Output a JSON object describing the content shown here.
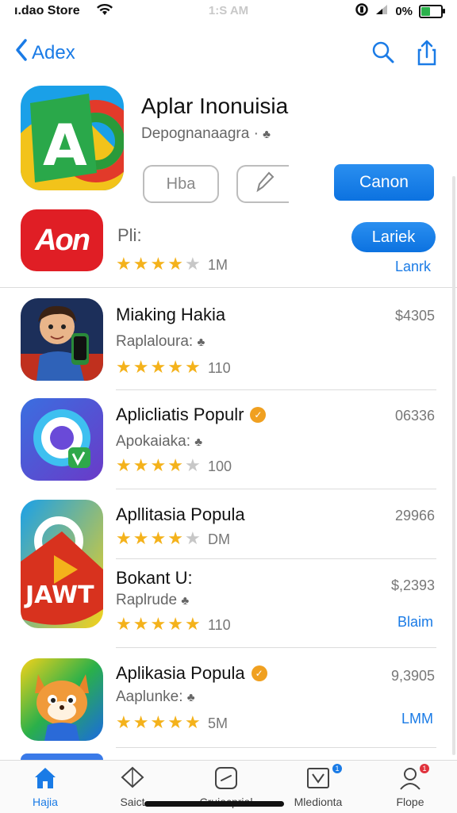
{
  "status_bar": {
    "carrier": "ı.dao Store",
    "time": "1:S AM",
    "battery": "0%",
    "battery_level": 0.5
  },
  "nav": {
    "back_label": "Adex"
  },
  "header_app": {
    "title": "Aplar Inonuisia",
    "subtitle": "Depognanaagra ·",
    "button_1": "Hba",
    "button_primary": "Canon"
  },
  "second_app": {
    "icon_text": "Aon",
    "label": "Pli:",
    "pill_button": "Lariek",
    "rating": 3.5,
    "count": "1M",
    "link": "Lanrk"
  },
  "list": [
    {
      "name": "Miaking Hakia",
      "subtitle": "Raplaloura:",
      "price": "$4305",
      "rating": 4.5,
      "count": "110",
      "verified": false
    },
    {
      "name": "Aplicliatis Populr",
      "subtitle": "Apokaiaka:",
      "price": "06336",
      "rating": 4,
      "count": "100",
      "verified": true
    },
    {
      "name": "Apllitasia Popula",
      "subtitle": "",
      "price": "29966",
      "rating": 3.5,
      "count": "DM",
      "verified": false
    },
    {
      "name": "Bokant U:",
      "subtitle": "Raplrude",
      "price": "$,2393",
      "action": "Blaim",
      "rating": 5,
      "count": "110",
      "verified": false
    },
    {
      "name": "Aplikasia Popula",
      "subtitle": "Aaplunke:",
      "price": "9,3905",
      "action": "LMM",
      "rating": 4.5,
      "count": "5M",
      "verified": true
    }
  ],
  "tabs": [
    {
      "label": "Hajia",
      "icon": "home-icon",
      "active": true
    },
    {
      "label": "Saict",
      "icon": "diamond-icon",
      "active": false
    },
    {
      "label": "Cruiocprial",
      "icon": "apps-icon",
      "active": false
    },
    {
      "label": "Mledionta",
      "icon": "media-icon",
      "active": false,
      "badge": "1"
    },
    {
      "label": "Flope",
      "icon": "profile-icon",
      "active": false,
      "badge": "1"
    }
  ],
  "colors": {
    "accent": "#1a7be6",
    "star": "#f4b21b",
    "badge_red": "#e0323c",
    "badge_blue": "#1a7be6"
  }
}
